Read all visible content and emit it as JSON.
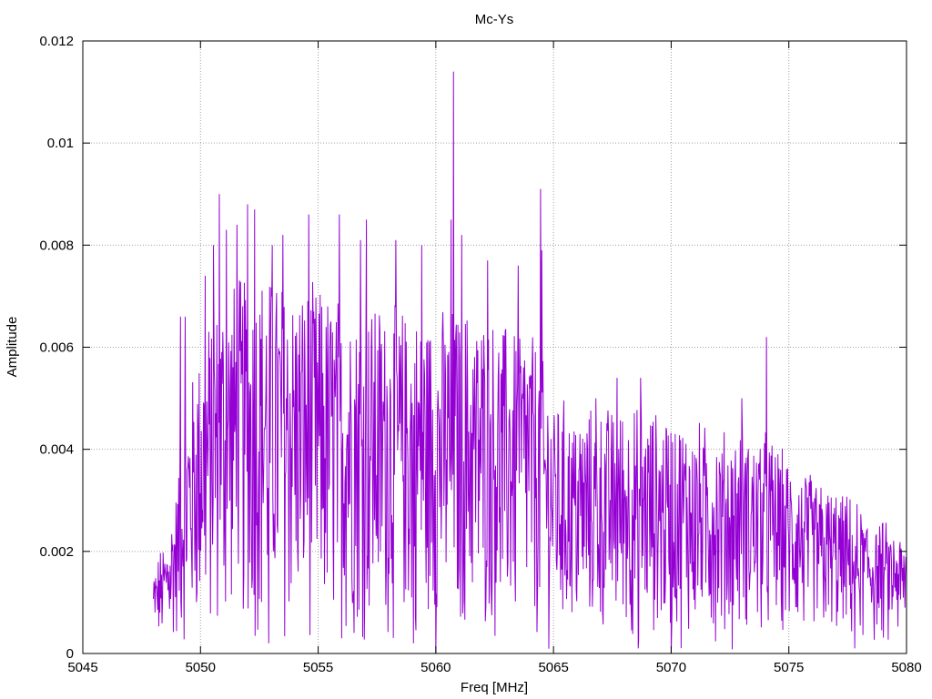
{
  "chart_data": {
    "type": "line",
    "title": "Mc-Ys",
    "xlabel": "Freq [MHz]",
    "ylabel": "Amplitude",
    "xlim": [
      5045,
      5080
    ],
    "ylim": [
      0,
      0.012
    ],
    "x_ticks": [
      "5045",
      "5050",
      "5055",
      "5060",
      "5065",
      "5070",
      "5075",
      "5080"
    ],
    "y_ticks": [
      "0",
      "0.002",
      "0.004",
      "0.006",
      "0.008",
      "0.01",
      "0.012"
    ],
    "grid": true,
    "series": [
      {
        "color": "#9400d3",
        "x_start": 5048.0,
        "x_end": 5080.0,
        "envelope": [
          [
            5048.0,
            0.0012
          ],
          [
            5048.5,
            0.0018
          ],
          [
            5049.0,
            0.0028
          ],
          [
            5049.5,
            0.0045
          ],
          [
            5050.0,
            0.0055
          ],
          [
            5051.0,
            0.0065
          ],
          [
            5052.0,
            0.0068
          ],
          [
            5053.0,
            0.0068
          ],
          [
            5054.0,
            0.0066
          ],
          [
            5055.0,
            0.0065
          ],
          [
            5056.0,
            0.0063
          ],
          [
            5057.0,
            0.0063
          ],
          [
            5058.0,
            0.0062
          ],
          [
            5059.0,
            0.006
          ],
          [
            5060.0,
            0.006
          ],
          [
            5061.0,
            0.0062
          ],
          [
            5062.0,
            0.006
          ],
          [
            5063.0,
            0.0058
          ],
          [
            5064.0,
            0.0058
          ],
          [
            5065.0,
            0.0045
          ],
          [
            5066.0,
            0.0042
          ],
          [
            5067.0,
            0.0042
          ],
          [
            5068.0,
            0.0043
          ],
          [
            5069.0,
            0.0042
          ],
          [
            5070.0,
            0.0041
          ],
          [
            5071.0,
            0.004
          ],
          [
            5072.0,
            0.0038
          ],
          [
            5073.0,
            0.0038
          ],
          [
            5074.0,
            0.0038
          ],
          [
            5075.0,
            0.0033
          ],
          [
            5076.0,
            0.003
          ],
          [
            5077.0,
            0.0027
          ],
          [
            5078.0,
            0.0024
          ],
          [
            5079.0,
            0.0021
          ],
          [
            5080.0,
            0.0018
          ]
        ],
        "peaks": [
          [
            5049.15,
            0.0066
          ],
          [
            5049.35,
            0.0066
          ],
          [
            5050.2,
            0.0074
          ],
          [
            5050.55,
            0.008
          ],
          [
            5050.8,
            0.009
          ],
          [
            5051.1,
            0.0083
          ],
          [
            5051.55,
            0.0084
          ],
          [
            5052.0,
            0.0088
          ],
          [
            5052.3,
            0.0087
          ],
          [
            5053.05,
            0.008
          ],
          [
            5053.5,
            0.0082
          ],
          [
            5054.6,
            0.0086
          ],
          [
            5055.9,
            0.0086
          ],
          [
            5056.8,
            0.0081
          ],
          [
            5057.05,
            0.0085
          ],
          [
            5058.3,
            0.0081
          ],
          [
            5059.4,
            0.008
          ],
          [
            5060.65,
            0.0085
          ],
          [
            5060.75,
            0.0114
          ],
          [
            5061.1,
            0.0082
          ],
          [
            5062.2,
            0.0077
          ],
          [
            5063.5,
            0.0076
          ],
          [
            5064.45,
            0.0091
          ],
          [
            5064.5,
            0.0079
          ],
          [
            5066.8,
            0.005
          ],
          [
            5067.7,
            0.0054
          ],
          [
            5068.7,
            0.0054
          ],
          [
            5070.0,
            0.0051
          ],
          [
            5073.0,
            0.005
          ],
          [
            5074.05,
            0.0062
          ]
        ],
        "dips": [
          [
            5052.9,
            0.0002
          ],
          [
            5059.05,
            0.0002
          ],
          [
            5060.0,
            0.0
          ],
          [
            5068.6,
            0.0001
          ],
          [
            5070.0,
            0.0
          ],
          [
            5077.8,
            0.0001
          ]
        ]
      }
    ]
  }
}
